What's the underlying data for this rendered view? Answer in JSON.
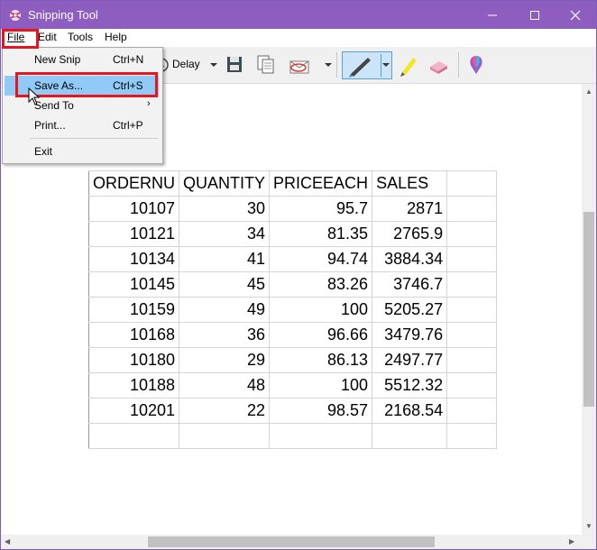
{
  "window": {
    "title": "Snipping Tool"
  },
  "menubar": {
    "file": "File",
    "edit": "Edit",
    "tools": "Tools",
    "help": "Help"
  },
  "toolbar": {
    "delay": "Delay",
    "pen_color": "#1e6fc8",
    "highlighter_color": "#f2e829"
  },
  "file_menu": {
    "items": [
      {
        "label": "New Snip",
        "shortcut": "Ctrl+N"
      },
      {
        "label": "Save As...",
        "shortcut": "Ctrl+S",
        "highlighted": true
      },
      {
        "label": "Send To",
        "shortcut": ""
      },
      {
        "label": "Print...",
        "shortcut": "Ctrl+P"
      },
      {
        "label": "Exit",
        "shortcut": ""
      }
    ]
  },
  "sheet": {
    "headers": [
      "ORDERNU",
      "QUANTITY",
      "PRICEEACH",
      "SALES"
    ],
    "rows": [
      [
        "10107",
        "30",
        "95.7",
        "2871"
      ],
      [
        "10121",
        "34",
        "81.35",
        "2765.9"
      ],
      [
        "10134",
        "41",
        "94.74",
        "3884.34"
      ],
      [
        "10145",
        "45",
        "83.26",
        "3746.7"
      ],
      [
        "10159",
        "49",
        "100",
        "5205.27"
      ],
      [
        "10168",
        "36",
        "96.66",
        "3479.76"
      ],
      [
        "10180",
        "29",
        "86.13",
        "2497.77"
      ],
      [
        "10188",
        "48",
        "100",
        "5512.32"
      ],
      [
        "10201",
        "22",
        "98.57",
        "2168.54"
      ]
    ]
  },
  "highlight_color": "#e8161c"
}
